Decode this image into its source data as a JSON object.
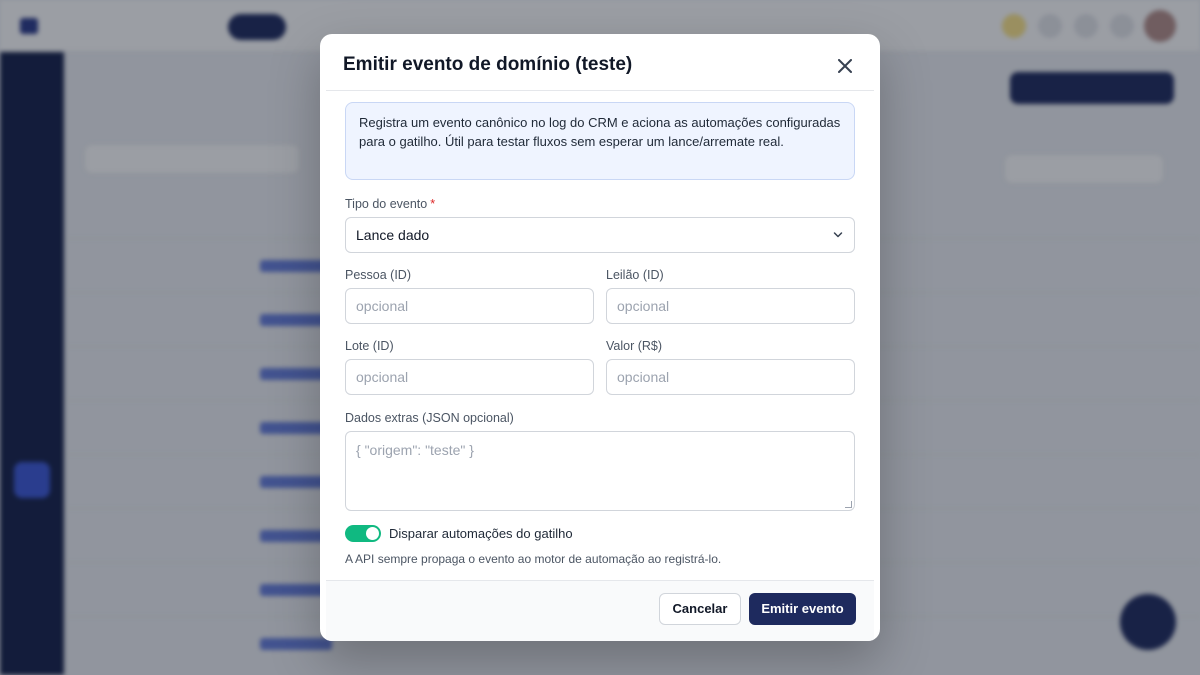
{
  "modal": {
    "title": "Emitir evento de domínio (teste)",
    "info": "Registra um evento canônico no log do CRM e aciona as automações configuradas para o gatilho. Útil para testar fluxos sem esperar um lance/arremate real.",
    "fields": {
      "event_type": {
        "label": "Tipo do evento",
        "required_mark": "*",
        "value": "Lance dado"
      },
      "person_id": {
        "label": "Pessoa (ID)",
        "placeholder": "opcional"
      },
      "auction_id": {
        "label": "Leilão (ID)",
        "placeholder": "opcional"
      },
      "lot_id": {
        "label": "Lote (ID)",
        "placeholder": "opcional"
      },
      "amount": {
        "label": "Valor (R$)",
        "placeholder": "opcional"
      },
      "extra_data": {
        "label": "Dados extras (JSON opcional)",
        "placeholder": "{ \"origem\": \"teste\" }"
      }
    },
    "toggle": {
      "label": "Disparar automações do gatilho",
      "checked": true
    },
    "hint": "A API sempre propaga o evento ao motor de automação ao registrá-lo.",
    "buttons": {
      "cancel": "Cancelar",
      "submit": "Emitir evento"
    }
  },
  "colors": {
    "primary": "#1e2a5e",
    "toggle_on": "#10b981",
    "info_bg": "#eff4ff",
    "required": "#dc2626"
  },
  "icons": {
    "close": "close-icon",
    "select_chevron": "chevron-down-icon"
  }
}
